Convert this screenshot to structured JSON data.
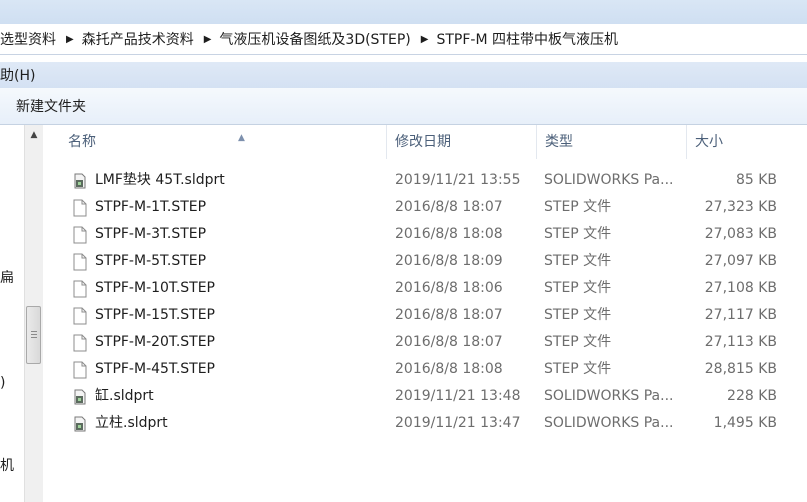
{
  "breadcrumb": [
    "选型资料",
    "森托产品技术资料",
    "气液压机设备图纸及3D(STEP)",
    "STPF-M 四柱带中板气液压机"
  ],
  "menu": {
    "help": "助(H)"
  },
  "toolbar": {
    "new_folder": "新建文件夹"
  },
  "nav": {
    "item1": "扁",
    "item2": ")",
    "item3": "机"
  },
  "columns": {
    "name": "名称",
    "date": "修改日期",
    "type": "类型",
    "size": "大小"
  },
  "files": [
    {
      "name": "LMF垫块 45T.sldprt",
      "date": "2019/11/21 13:55",
      "type": "SOLIDWORKS Pa...",
      "size": "85 KB",
      "icon": "solidworks-part-icon"
    },
    {
      "name": "STPF-M-1T.STEP",
      "date": "2016/8/8 18:07",
      "type": "STEP 文件",
      "size": "27,323 KB",
      "icon": "file-icon"
    },
    {
      "name": "STPF-M-3T.STEP",
      "date": "2016/8/8 18:08",
      "type": "STEP 文件",
      "size": "27,083 KB",
      "icon": "file-icon"
    },
    {
      "name": "STPF-M-5T.STEP",
      "date": "2016/8/8 18:09",
      "type": "STEP 文件",
      "size": "27,097 KB",
      "icon": "file-icon"
    },
    {
      "name": "STPF-M-10T.STEP",
      "date": "2016/8/8 18:06",
      "type": "STEP 文件",
      "size": "27,108 KB",
      "icon": "file-icon"
    },
    {
      "name": "STPF-M-15T.STEP",
      "date": "2016/8/8 18:07",
      "type": "STEP 文件",
      "size": "27,117 KB",
      "icon": "file-icon"
    },
    {
      "name": "STPF-M-20T.STEP",
      "date": "2016/8/8 18:07",
      "type": "STEP 文件",
      "size": "27,113 KB",
      "icon": "file-icon"
    },
    {
      "name": "STPF-M-45T.STEP",
      "date": "2016/8/8 18:08",
      "type": "STEP 文件",
      "size": "28,815 KB",
      "icon": "file-icon"
    },
    {
      "name": "缸.sldprt",
      "date": "2019/11/21 13:48",
      "type": "SOLIDWORKS Pa...",
      "size": "228 KB",
      "icon": "solidworks-part-icon"
    },
    {
      "name": "立柱.sldprt",
      "date": "2019/11/21 13:47",
      "type": "SOLIDWORKS Pa...",
      "size": "1,495 KB",
      "icon": "solidworks-part-icon"
    }
  ]
}
